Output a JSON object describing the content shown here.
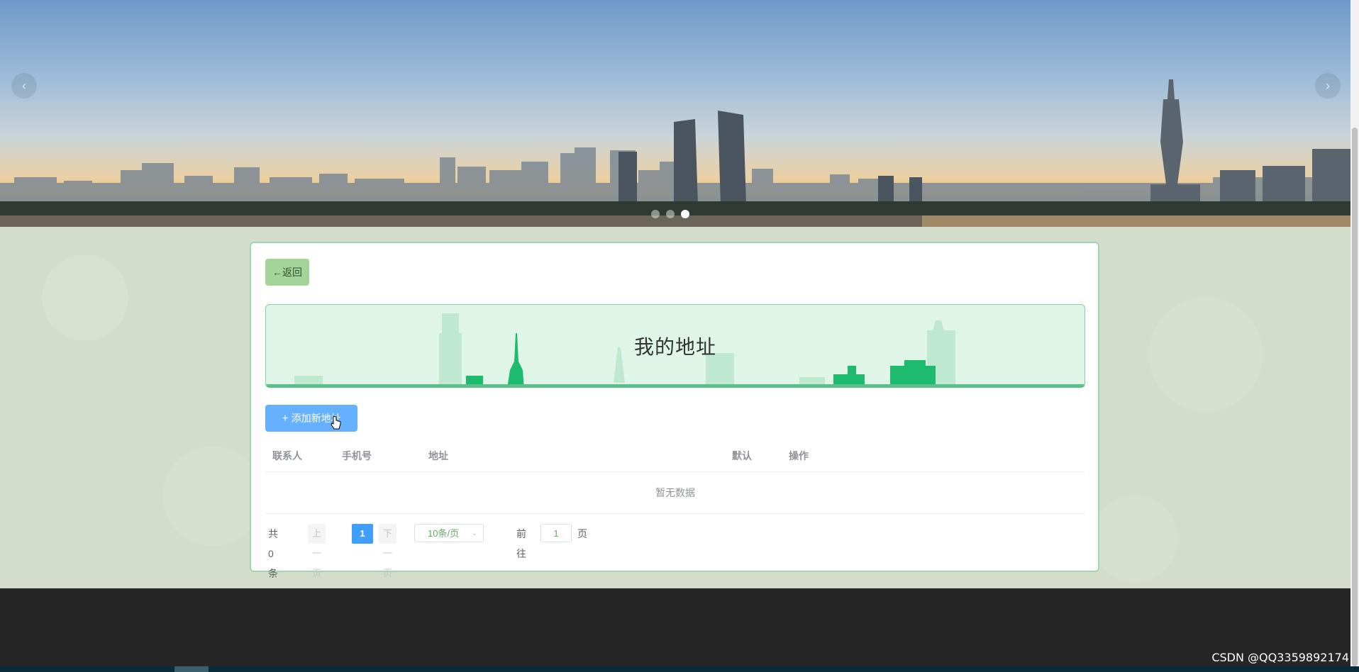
{
  "carousel": {
    "prev_icon": "chevron-left-icon",
    "next_icon": "chevron-right-icon",
    "prev_glyph": "‹",
    "next_glyph": "›",
    "slide_count": 3,
    "active_slide": 3
  },
  "page": {
    "back_label": "←返回",
    "title": "我的地址",
    "add_label": "添加新地址",
    "add_icon": "plus-icon",
    "add_glyph": "+"
  },
  "table": {
    "columns": [
      "联系人",
      "手机号",
      "地址",
      "默认",
      "操作"
    ],
    "empty_text": "暂无数据"
  },
  "pagination": {
    "total": "共 0 条",
    "prev": "上一页",
    "current": "1",
    "next": "下一页",
    "page_size": "10条/页",
    "goto_label": "前往",
    "goto_value": "1",
    "page_label": "页"
  },
  "watermark": "CSDN @QQ3359892174",
  "colors": {
    "primary": "#409eff",
    "add_button": "#66b1ff",
    "back_button": "#a4d49a",
    "title_banner": "#dff5e8",
    "card_border": "#9ed6b0",
    "footer": "#262626"
  }
}
